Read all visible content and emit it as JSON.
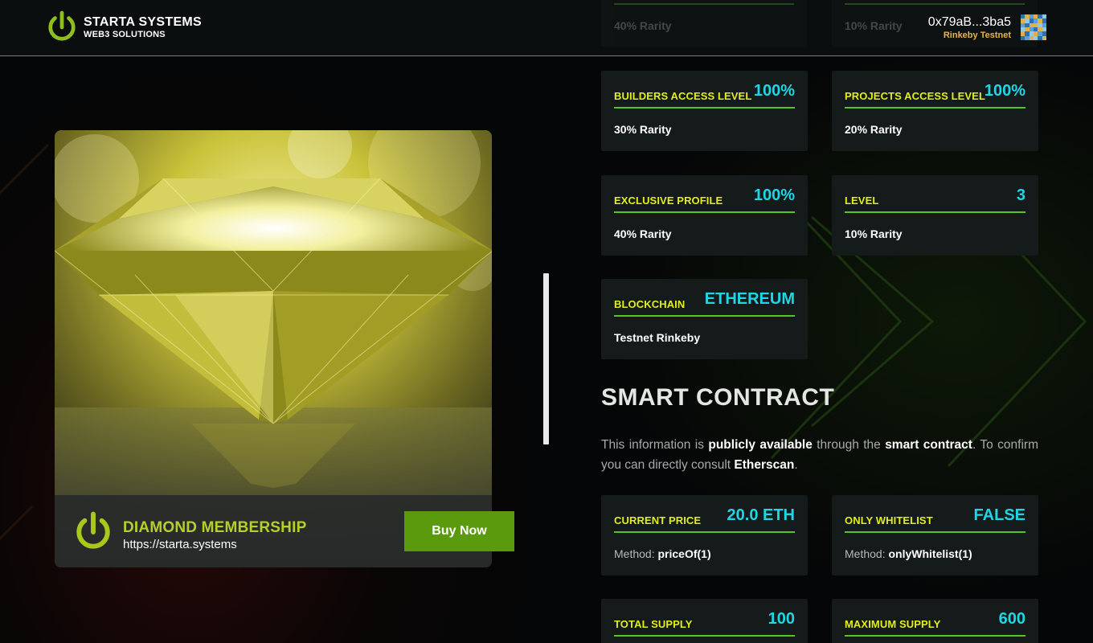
{
  "header": {
    "brand_title": "STARTA SYSTEMS",
    "brand_subtitle": "WEB3 SOLUTIONS",
    "ghost_cards": [
      "40% Rarity",
      "10% Rarity"
    ],
    "wallet_address": "0x79aB...3ba5",
    "wallet_network": "Rinkeby Testnet"
  },
  "nft": {
    "name": "DIAMOND MEMBERSHIP",
    "url": "https://starta.systems",
    "buy_label": "Buy Now"
  },
  "attributes": [
    {
      "label": "BUILDERS ACCESS LEVEL",
      "value": "100%",
      "sub": "30% Rarity"
    },
    {
      "label": "PROJECTS ACCESS LEVEL",
      "value": "100%",
      "sub": "20% Rarity"
    },
    {
      "label": "EXCLUSIVE PROFILE",
      "value": "100%",
      "sub": "40% Rarity"
    },
    {
      "label": "LEVEL",
      "value": "3",
      "sub": "10% Rarity"
    },
    {
      "label": "BLOCKCHAIN",
      "value": "ETHEREUM",
      "sub": "Testnet Rinkeby"
    }
  ],
  "smart_contract": {
    "title": "SMART CONTRACT",
    "desc_1": "This information is ",
    "desc_b1": "publicly available",
    "desc_2": " through the ",
    "desc_b2": "smart contract",
    "desc_3": ". To confirm you can directly consult ",
    "desc_b3": "Etherscan",
    "desc_4": ".",
    "method_prefix": "Method: ",
    "cards": [
      {
        "label": "CURRENT PRICE",
        "value": "20.0 ETH",
        "method": "priceOf(1)"
      },
      {
        "label": "ONLY WHITELIST",
        "value": "FALSE",
        "method": "onlyWhitelist(1)"
      },
      {
        "label": "TOTAL SUPPLY",
        "value": "100"
      },
      {
        "label": "MAXIMUM SUPPLY",
        "value": "600"
      }
    ]
  },
  "colors": {
    "accent_green": "#58c61c",
    "label_yellow": "#e2ee1c",
    "value_cyan": "#1fd6e6",
    "button_green": "#5c9a0d",
    "network_orange": "#e8b54a"
  },
  "icons": [
    "power-logo-icon",
    "identicon-avatar"
  ]
}
